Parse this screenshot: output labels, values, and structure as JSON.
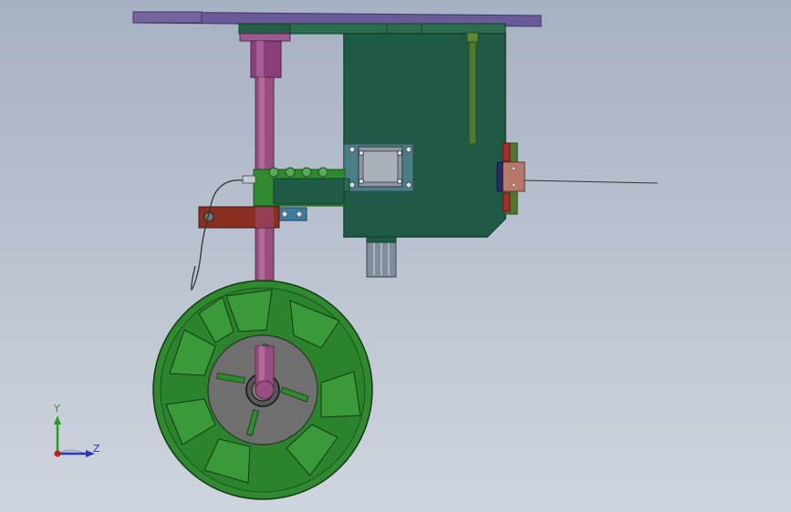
{
  "viewport": {
    "background_top": "#a6b1c2",
    "background_bottom": "#cfd5de"
  },
  "model": {
    "colors": {
      "top_plate": "#6a5a9a",
      "main_block": "#1f5a46",
      "main_block_edge": "#163f32",
      "rod": "#9a4d80",
      "rod_collar": "#8a3f78",
      "wheel_outer": "#2f8a2f",
      "wheel_hub": "#6f6f6f",
      "bracket": "#8a2f1f",
      "arm": "#2f8a2f",
      "motor": "#8a9aa8",
      "side_block": "#b8786a",
      "wire": "#333333"
    }
  },
  "triad": {
    "y_label": "Y",
    "z_label": "Z",
    "y_color": "#2a9a2a",
    "z_color": "#2b3bb0",
    "x_color": "#c02020"
  }
}
